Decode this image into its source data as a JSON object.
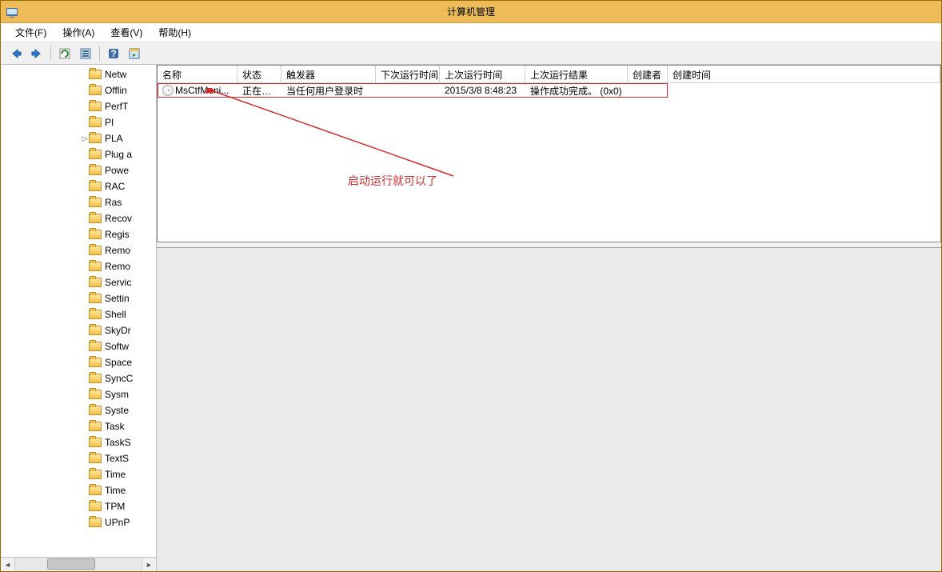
{
  "window": {
    "title": "计算机管理"
  },
  "menu": {
    "file": "文件(F)",
    "action": "操作(A)",
    "view": "查看(V)",
    "help": "帮助(H)"
  },
  "tree": {
    "items": [
      {
        "label": "Netw",
        "expander": false
      },
      {
        "label": "Offlin",
        "expander": false
      },
      {
        "label": "PerfT",
        "expander": false
      },
      {
        "label": "PI",
        "expander": false
      },
      {
        "label": "PLA",
        "expander": true
      },
      {
        "label": "Plug a",
        "expander": false
      },
      {
        "label": "Powe",
        "expander": false
      },
      {
        "label": "RAC",
        "expander": false
      },
      {
        "label": "Ras",
        "expander": false
      },
      {
        "label": "Recov",
        "expander": false
      },
      {
        "label": "Regis",
        "expander": false
      },
      {
        "label": "Remo",
        "expander": false
      },
      {
        "label": "Remo",
        "expander": false
      },
      {
        "label": "Servic",
        "expander": false
      },
      {
        "label": "Settin",
        "expander": false
      },
      {
        "label": "Shell",
        "expander": false
      },
      {
        "label": "SkyDr",
        "expander": false
      },
      {
        "label": "Softw",
        "expander": false
      },
      {
        "label": "Space",
        "expander": false
      },
      {
        "label": "SyncC",
        "expander": false
      },
      {
        "label": "Sysm",
        "expander": false
      },
      {
        "label": "Syste",
        "expander": false
      },
      {
        "label": "Task",
        "expander": false
      },
      {
        "label": "TaskS",
        "expander": false
      },
      {
        "label": "TextS",
        "expander": false
      },
      {
        "label": "Time",
        "expander": false
      },
      {
        "label": "Time",
        "expander": false
      },
      {
        "label": "TPM",
        "expander": false
      },
      {
        "label": "UPnP",
        "expander": false
      }
    ]
  },
  "columns": {
    "name": "名称",
    "status": "状态",
    "triggers": "触发器",
    "nextRun": "下次运行时间",
    "lastRun": "上次运行时间",
    "lastResult": "上次运行结果",
    "author": "创建者",
    "created": "创建时间"
  },
  "rows": [
    {
      "name": "MsCtfMoni...",
      "status": "正在运行",
      "triggers": "当任何用户登录时",
      "nextRun": "",
      "lastRun": "2015/3/8 8:48:23",
      "lastResult": "操作成功完成。 (0x0)",
      "author": "",
      "created": ""
    }
  ],
  "annotation": {
    "text": "启动运行就可以了"
  }
}
